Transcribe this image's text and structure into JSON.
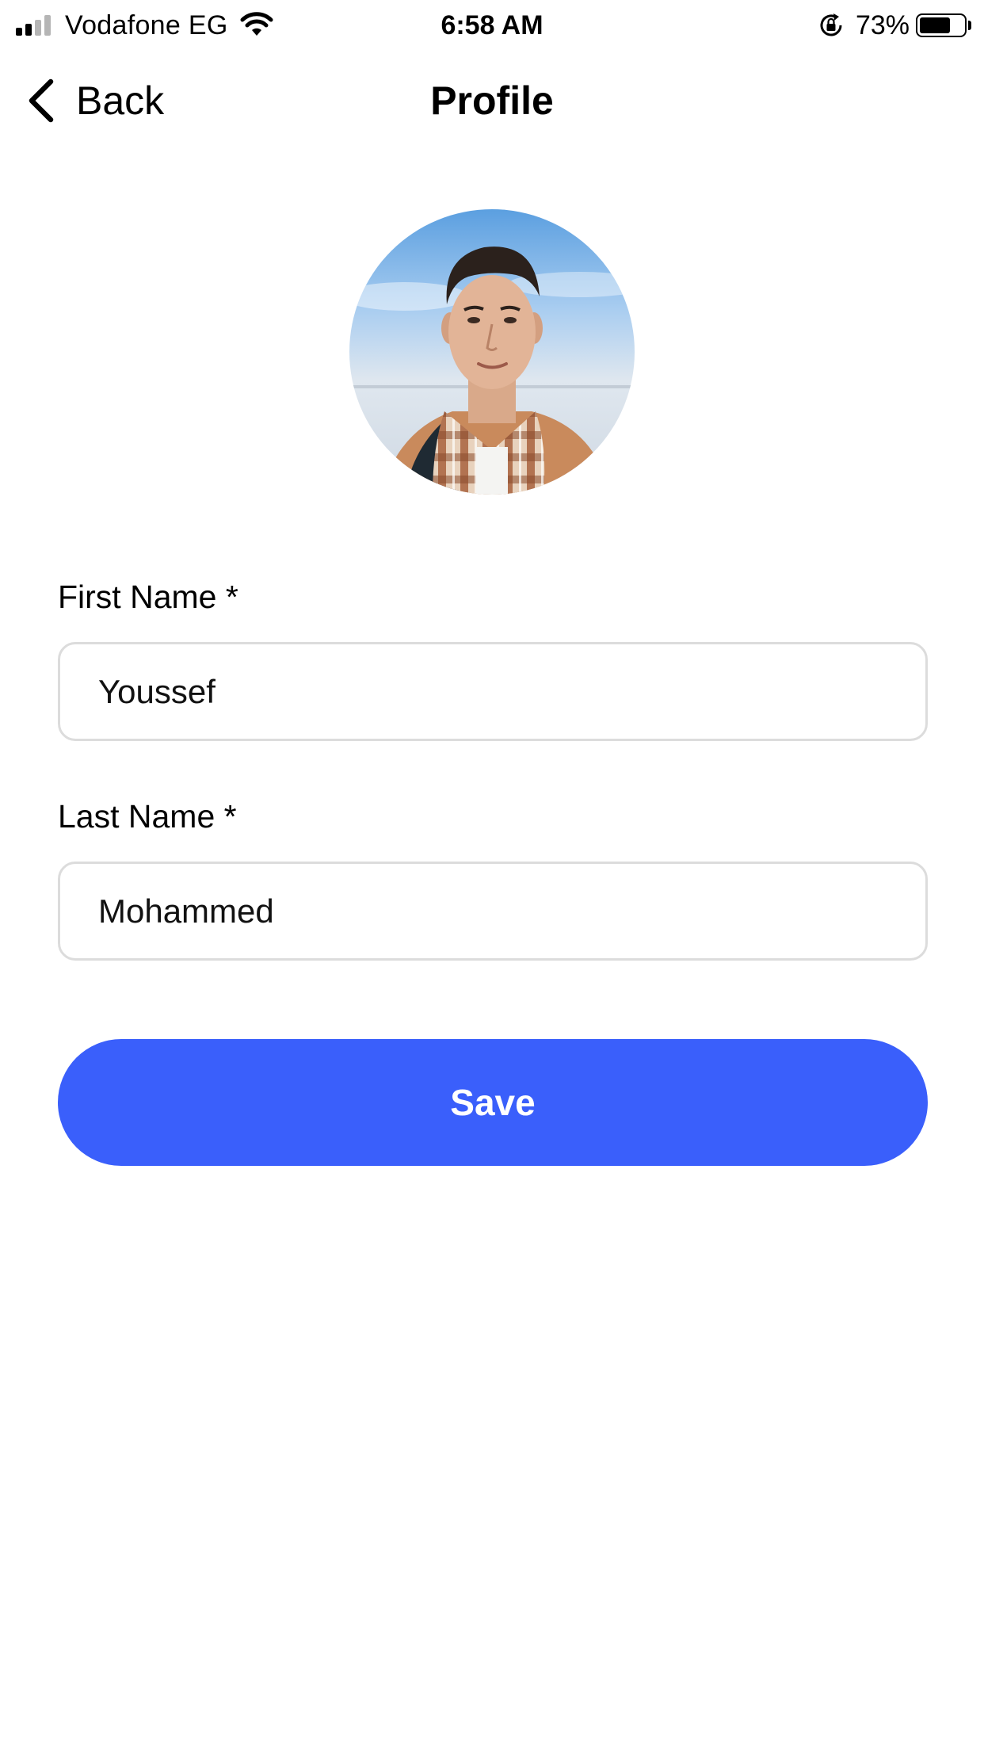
{
  "status_bar": {
    "carrier": "Vodafone EG",
    "time": "6:58 AM",
    "battery_percent": "73%",
    "battery_level": 0.73,
    "signal_bars_active": 2,
    "signal_bars_total": 4,
    "icons": [
      "signal-icon",
      "wifi-icon",
      "orientation-lock-icon",
      "battery-icon"
    ]
  },
  "nav": {
    "back_label": "Back",
    "title": "Profile",
    "back_icon": "chevron-left-icon"
  },
  "form": {
    "first_name_label": "First Name *",
    "first_name_value": "Youssef",
    "last_name_label": "Last Name *",
    "last_name_value": "Mohammed",
    "save_label": "Save"
  },
  "colors": {
    "accent": "#3a5ffb",
    "input_border": "#dcdcdc",
    "background": "#ffffff"
  }
}
